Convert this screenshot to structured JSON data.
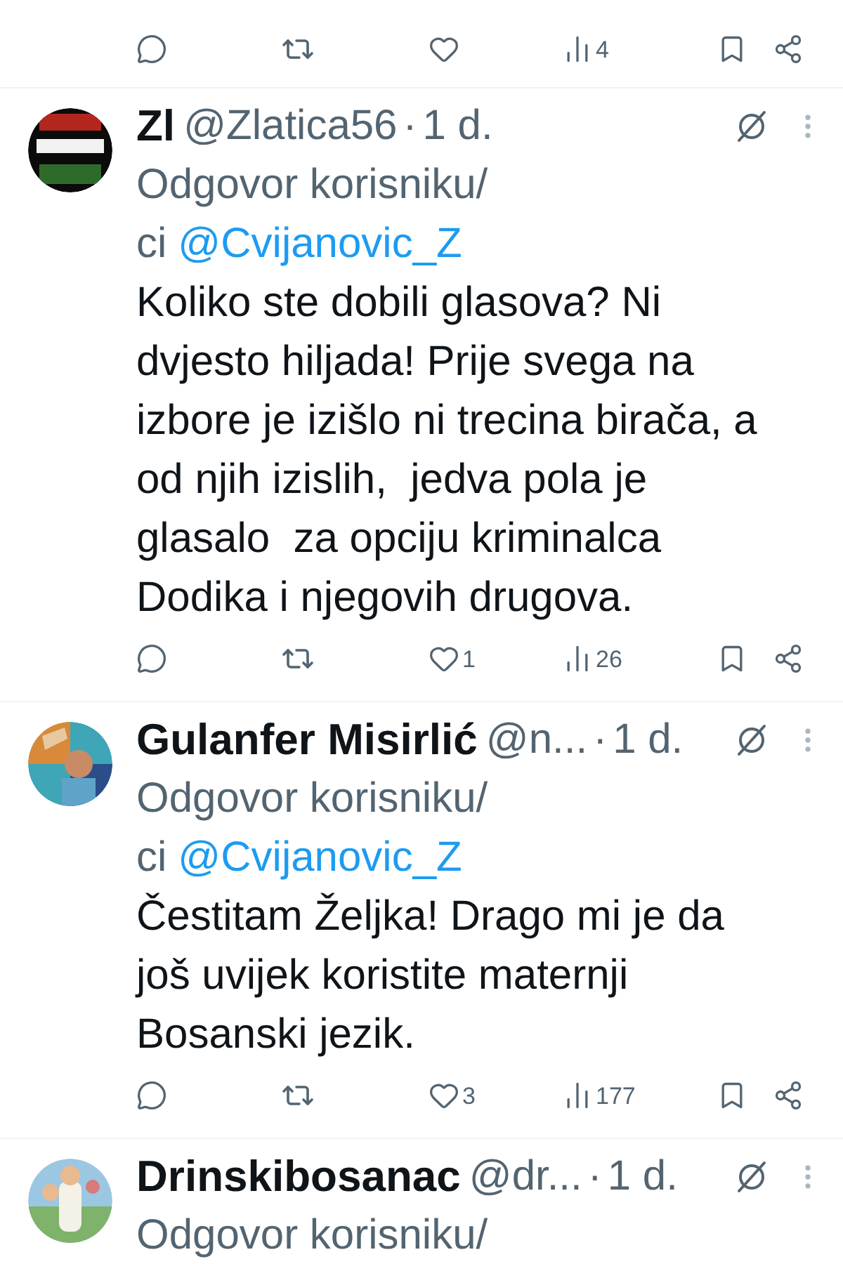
{
  "top_tweet_actions": {
    "views": "4"
  },
  "tweets": [
    {
      "name": "Zl",
      "handle": "@Zlatica56",
      "separator": "·",
      "time": "1 d.",
      "reply": {
        "text": "Odgovor korisniku/",
        "continuation": "ci",
        "mention": "@Cvijanovic_Z"
      },
      "body": "Koliko ste dobili glasova? Ni dvjesto hiljada! Prije svega na izbore je izišlo ni trecina birača, a od njih izislih,  jedva pola je glasalo  za opciju kriminalca Dodika i njegovih drugova.",
      "actions": {
        "likes": "1",
        "views": "26"
      }
    },
    {
      "name": "Gulanfer Misirlić",
      "handle": "@n...",
      "separator": "·",
      "time": "1 d.",
      "reply": {
        "text": "Odgovor korisniku/",
        "continuation": "ci",
        "mention": "@Cvijanovic_Z"
      },
      "body": "Čestitam Željka! Drago mi je da još uvijek koristite maternji Bosanski jezik.",
      "actions": {
        "likes": "3",
        "views": "177"
      }
    },
    {
      "name": "Drinskibosanac",
      "handle": "@dr...",
      "separator": "·",
      "time": "1 d.",
      "reply": {
        "text": "Odgovor korisniku/"
      }
    }
  ]
}
